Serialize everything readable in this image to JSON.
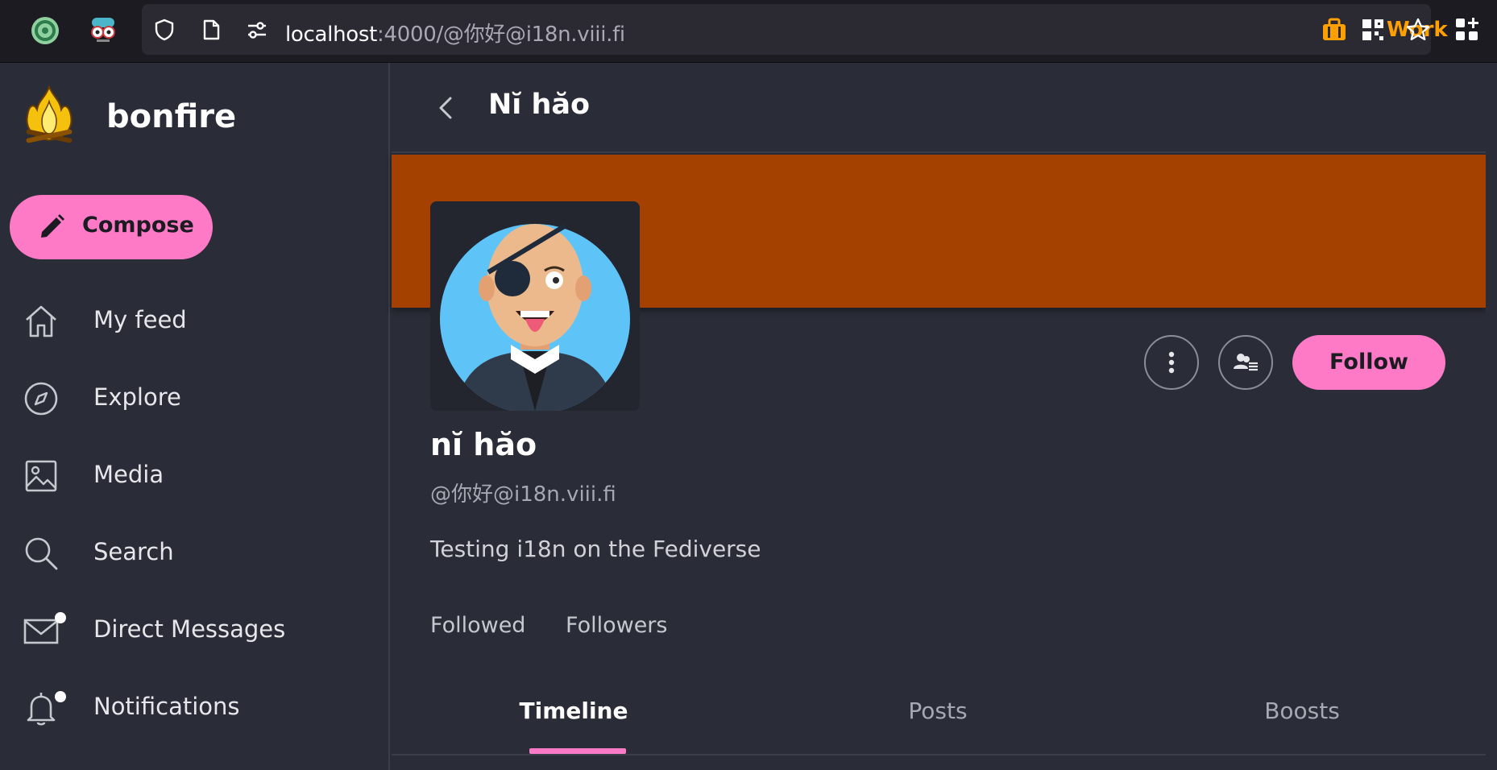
{
  "browser": {
    "url_host": "localhost",
    "url_rest": ":4000/@你好@i18n.viii.fi",
    "container_label": "Work",
    "container_color": "#ff9f00",
    "icons": [
      "extension-green-icon",
      "extension-glasses-icon",
      "shield-icon",
      "page-icon",
      "permissions-icon",
      "container-briefcase-icon",
      "qr-code-icon",
      "bookmark-star-icon",
      "extensions-grid-icon"
    ]
  },
  "sidebar": {
    "brand": "bonfire",
    "compose_label": "Compose",
    "items": [
      {
        "label": "My feed",
        "icon": "home-icon"
      },
      {
        "label": "Explore",
        "icon": "compass-icon"
      },
      {
        "label": "Media",
        "icon": "image-icon"
      },
      {
        "label": "Search",
        "icon": "search-icon"
      },
      {
        "label": "Direct Messages",
        "icon": "mail-icon",
        "has_dot": true
      },
      {
        "label": "Notifications",
        "icon": "bell-icon",
        "has_dot": true
      }
    ]
  },
  "main": {
    "title": "Nĭ hăo",
    "profile": {
      "display_name": "nĭ hăo",
      "handle": "@你好@i18n.viii.fi",
      "bio": "Testing i18n on the Fediverse",
      "follow_label": "Follow",
      "stats": [
        "Followed",
        "Followers"
      ]
    },
    "tabs": [
      {
        "label": "Timeline",
        "active": true
      },
      {
        "label": "Posts",
        "active": false
      },
      {
        "label": "Boosts",
        "active": false
      }
    ]
  },
  "colors": {
    "accent": "#ff7ac6",
    "banner": "#a54100",
    "background": "#2a2c37"
  }
}
